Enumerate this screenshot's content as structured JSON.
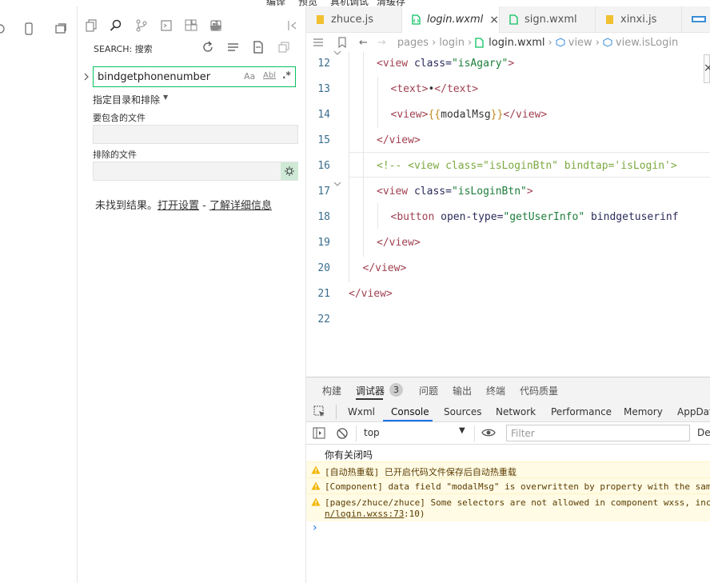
{
  "top_menu": [
    "编译",
    "预览",
    "真机调试",
    "清缓存"
  ],
  "search": {
    "title": "SEARCH: 搜索",
    "query": "bindgetphonenumber",
    "match_case": "Aa",
    "whole_word": "Abl",
    "regex": ".*",
    "dirs_toggle": "指定目录和排除",
    "include_label": "要包含的文件",
    "exclude_label": "排除的文件",
    "no_results": "未找到结果。",
    "open_settings": "打开设置",
    "separator": " - ",
    "learn_more": "了解详细信息"
  },
  "tabs": [
    {
      "name": "zhuce.js",
      "active": false
    },
    {
      "name": "login.wxml",
      "active": true,
      "close": "×"
    },
    {
      "name": "sign.wxml",
      "active": false
    },
    {
      "name": "xinxi.js",
      "active": false
    }
  ],
  "breadcrumb": [
    "pages",
    "login",
    "login.wxml",
    "view",
    "view.isLogin"
  ],
  "code_lines": [
    {
      "n": "12",
      "indent": "    ",
      "parts": [
        [
          "tg",
          "<view "
        ],
        [
          "at",
          "class="
        ],
        [
          "st",
          "\"isAgary\""
        ],
        [
          "tg",
          ">"
        ]
      ]
    },
    {
      "n": "13",
      "indent": "      ",
      "parts": [
        [
          "tg",
          "<text>"
        ],
        [
          "tx",
          "•"
        ],
        [
          "tg",
          "</text>"
        ]
      ]
    },
    {
      "n": "14",
      "indent": "      ",
      "parts": [
        [
          "tg",
          "<view>"
        ],
        [
          "br",
          "{{"
        ],
        [
          "tx",
          "modalMsg"
        ],
        [
          "br",
          "}}"
        ],
        [
          "tg",
          "</view>"
        ]
      ]
    },
    {
      "n": "15",
      "indent": "    ",
      "parts": [
        [
          "tg",
          "</view>"
        ]
      ]
    },
    {
      "n": "16",
      "indent": "    ",
      "parts": [
        [
          "cm",
          "<!-- <view class=\"isLoginBtn\" bindtap='isLogin'>"
        ]
      ]
    },
    {
      "n": "17",
      "indent": "    ",
      "parts": [
        [
          "tg",
          "<view "
        ],
        [
          "at",
          "class="
        ],
        [
          "st",
          "\"isLoginBtn\""
        ],
        [
          "tg",
          ">"
        ]
      ]
    },
    {
      "n": "18",
      "indent": "      ",
      "parts": [
        [
          "tg",
          "<button "
        ],
        [
          "at",
          "open-type="
        ],
        [
          "st",
          "\"getUserInfo\""
        ],
        [
          "at",
          " bindgetuserinf"
        ]
      ]
    },
    {
      "n": "19",
      "indent": "    ",
      "parts": [
        [
          "tg",
          "</view>"
        ]
      ]
    },
    {
      "n": "20",
      "indent": "  ",
      "parts": [
        [
          "tg",
          "</view>"
        ]
      ]
    },
    {
      "n": "21",
      "indent": "",
      "parts": [
        [
          "tg",
          "</view>"
        ]
      ]
    },
    {
      "n": "22",
      "indent": "",
      "parts": []
    }
  ],
  "panel_tabs": [
    {
      "label": "构建"
    },
    {
      "label": "调试器",
      "badge": "3",
      "active": true
    },
    {
      "label": "问题"
    },
    {
      "label": "输出"
    },
    {
      "label": "终端"
    },
    {
      "label": "代码质量"
    }
  ],
  "devtools_tabs": [
    "Wxml",
    "Console",
    "Sources",
    "Network",
    "Performance",
    "Memory",
    "AppDat"
  ],
  "devtools_active": "Console",
  "console": {
    "context": "top",
    "filter_placeholder": "Filter",
    "levels": "Def"
  },
  "console_messages": [
    {
      "type": "log",
      "text": "你有关闭吗"
    },
    {
      "type": "warn",
      "text": "[自动热重载] 已开启代码文件保存后自动热重载"
    },
    {
      "type": "warn",
      "text": "[Component] data field \"modalMsg\" is overwritten by property with the sam"
    },
    {
      "type": "warn",
      "text": "[pages/zhuce/zhuce] Some selectors are not allowed in component wxss, inc",
      "link": "n/login.wxss:73",
      "link_suffix": ":10)"
    }
  ],
  "prompt": "›",
  "colors": {
    "accent": "#07c160",
    "warning_bg": "#fffbe5",
    "tag": "#a04050",
    "string": "#1c7c3a",
    "comment": "#7ca940"
  }
}
